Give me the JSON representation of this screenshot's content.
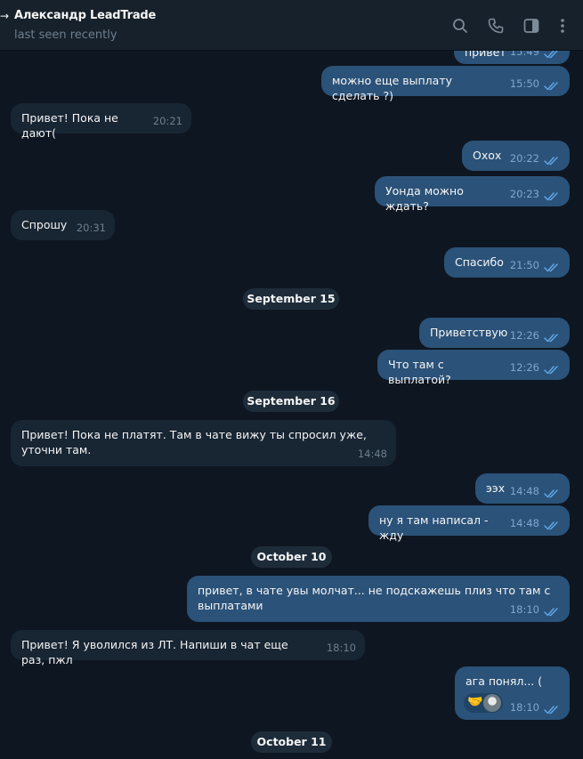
{
  "header": {
    "back_glyph": "→",
    "title": "Александр LeadTrade",
    "status": "last seen recently",
    "icons": [
      "search-icon",
      "phone-icon",
      "sidebar-toggle-icon",
      "more-vert-icon"
    ]
  },
  "colors": {
    "background": "#0e1621",
    "header": "#17212b",
    "incoming_bubble": "#182533",
    "outgoing_bubble": "#2b5278",
    "check_color": "#5fa6e6"
  },
  "messages": [
    {
      "dir": "out",
      "text": "привет",
      "time": "15:49"
    },
    {
      "dir": "out",
      "text": "можно еще выплату сделать ?)",
      "time": "15:50"
    },
    {
      "dir": "in",
      "text": "Привет! Пока не дают(",
      "time": "20:21"
    },
    {
      "dir": "out",
      "text": "Охох",
      "time": "20:22"
    },
    {
      "dir": "out",
      "text": "Уонда можно ждать?",
      "time": "20:23"
    },
    {
      "dir": "in",
      "text": "Спрошу",
      "time": "20:31"
    },
    {
      "dir": "out",
      "text": "Спасибо",
      "time": "21:50"
    },
    {
      "date": "September 15"
    },
    {
      "dir": "out",
      "text": "Приветствую",
      "time": "12:26"
    },
    {
      "dir": "out",
      "text": "Что там с выплатой?",
      "time": "12:26"
    },
    {
      "date": "September 16"
    },
    {
      "dir": "in",
      "text": "Привет! Пока не платят. Там в чате вижу ты спросил уже, уточни там.",
      "time": "14:48"
    },
    {
      "dir": "out",
      "text": "ээх",
      "time": "14:48"
    },
    {
      "dir": "out",
      "text": "ну я там написал - жду",
      "time": "14:48"
    },
    {
      "date": "October 10"
    },
    {
      "dir": "out",
      "text": "привет, в чате увы молчат... не подскажешь плиз что там с выплатами",
      "time": "18:10"
    },
    {
      "dir": "in",
      "text": "Привет! Я уволился из ЛТ. Напиши в чат еще раз, пжл",
      "time": "18:10"
    },
    {
      "dir": "out",
      "text": "ага понял... (",
      "time": "18:10",
      "reaction": "handshake"
    },
    {
      "date": "October 11"
    }
  ]
}
